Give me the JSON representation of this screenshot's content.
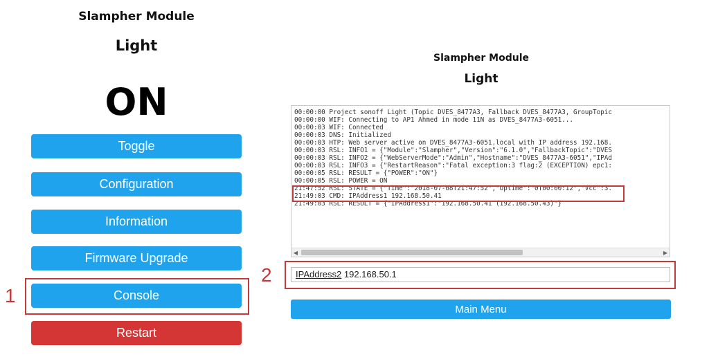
{
  "left": {
    "module_title": "Slampher Module",
    "device_name": "Light",
    "state": "ON",
    "buttons": [
      {
        "label": "Toggle"
      },
      {
        "label": "Configuration"
      },
      {
        "label": "Information"
      },
      {
        "label": "Firmware Upgrade"
      },
      {
        "label": "Console"
      },
      {
        "label": "Restart"
      }
    ],
    "marker": "1"
  },
  "right": {
    "module_title": "Slampher Module",
    "device_name": "Light",
    "console_lines": [
      "00:00:00 Project sonoff Light (Topic DVES_8477A3, Fallback DVES_8477A3, GroupTopic",
      "00:00:00 WIF: Connecting to AP1 Ahmed in mode 11N as DVES_8477A3-6051...",
      "00:00:03 WIF: Connected",
      "00:00:03 DNS: Initialized",
      "00:00:03 HTP: Web server active on DVES_8477A3-6051.local with IP address 192.168.",
      "00:00:03 RSL: INFO1 = {\"Module\":\"Slampher\",\"Version\":\"6.1.0\",\"FallbackTopic\":\"DVES",
      "00:00:03 RSL: INFO2 = {\"WebServerMode\":\"Admin\",\"Hostname\":\"DVES_8477A3-6051\",\"IPAd",
      "00:00:03 RSL: INFO3 = {\"RestartReason\":\"Fatal exception:3 flag:2 (EXCEPTION) epc1:",
      "00:00:05 RSL: RESULT = {\"POWER\":\"ON\"}",
      "00:00:05 RSL: POWER = ON",
      "21:47:52 RSL: STATE = {\"Time\":\"2018-07-08T21:47:52\",\"Uptime\":\"0T00:00:12\",\"Vcc\":3.",
      "21:49:03 CMD: IPAddress1 192.168.50.41",
      "21:49:03 RSL: RESULT = {\"IPAddress1\":\"192.168.50.41 (192.168.50.43)\"}"
    ],
    "command_input": {
      "command": "IPAddress2",
      "argument": " 192.168.50.1"
    },
    "main_menu_label": "Main Menu",
    "marker": "2"
  },
  "colors": {
    "button_blue": "#1fa3ec",
    "restart_red": "#d43535",
    "highlight_red": "#c23a3a"
  }
}
